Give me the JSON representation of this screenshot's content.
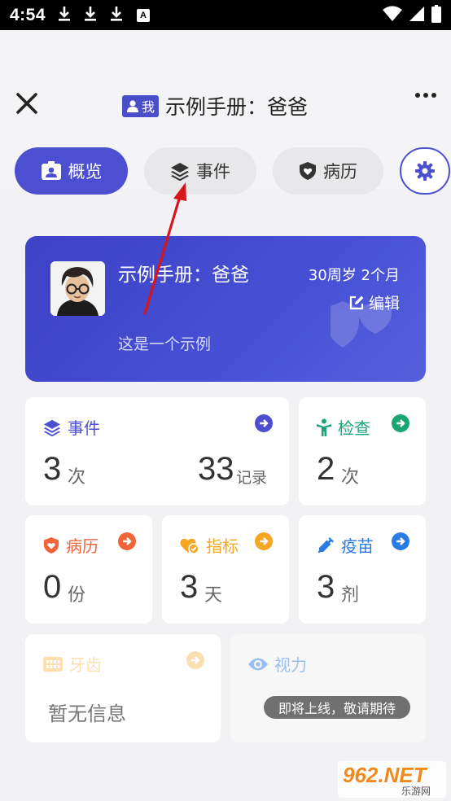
{
  "status_bar": {
    "time": "4:54",
    "badge": "A"
  },
  "header": {
    "me_badge": "我",
    "title": "示例手册：爸爸"
  },
  "tabs": [
    {
      "label": "概览",
      "active": true
    },
    {
      "label": "事件",
      "active": false
    },
    {
      "label": "病历",
      "active": false
    }
  ],
  "profile": {
    "name": "示例手册：爸爸",
    "age": "30周岁 2个月",
    "edit_label": "编辑",
    "description": "这是一个示例"
  },
  "cards": {
    "events": {
      "title": "事件",
      "count": "3",
      "count_unit": "次",
      "records": "33",
      "records_unit": "记录",
      "color": "#4b4fd0"
    },
    "checkup": {
      "title": "检查",
      "count": "2",
      "unit": "次",
      "color": "#1aa672"
    },
    "medical": {
      "title": "病历",
      "count": "0",
      "unit": "份",
      "color": "#f0643a"
    },
    "indicators": {
      "title": "指标",
      "count": "3",
      "unit": "天",
      "color": "#f5a623"
    },
    "vaccine": {
      "title": "疫苗",
      "count": "3",
      "unit": "剂",
      "color": "#2a7be4"
    },
    "teeth": {
      "title": "牙齿",
      "empty": "暂无信息",
      "color": "#f5a623"
    },
    "vision": {
      "title": "视力",
      "coming": "即将上线，敬请期待",
      "color": "#2a7be4"
    }
  },
  "watermark": {
    "text": "962.NET",
    "sub": "乐游网"
  }
}
